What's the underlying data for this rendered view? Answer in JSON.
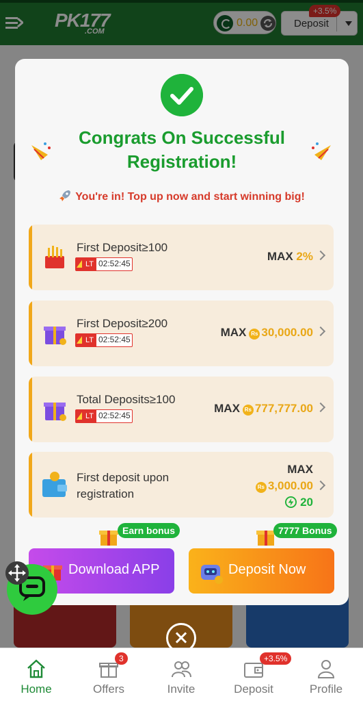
{
  "header": {
    "logo": "PK177",
    "logo_sub": ".COM",
    "balance": "0.00",
    "deposit_label": "Deposit",
    "deposit_badge": "+3.5%"
  },
  "modal": {
    "title": "Congrats On Successful Registration!",
    "subtitle": "You're in! Top up now and start winning big!",
    "bonuses": [
      {
        "title": "First Deposit≥100",
        "lt": "LT",
        "timer": "02:52:45",
        "max_label": "MAX",
        "max_value": "2%"
      },
      {
        "title": "First Deposit≥200",
        "lt": "LT",
        "timer": "02:52:45",
        "max_label": "MAX",
        "max_value": "30,000.00"
      },
      {
        "title": "Total Deposits≥100",
        "lt": "LT",
        "timer": "02:52:45",
        "max_label": "MAX",
        "max_value": "777,777.00"
      },
      {
        "title": "First deposit upon registration",
        "max_label": "MAX",
        "max_value": "3,000.00",
        "extra_value": "20"
      }
    ],
    "currency_symbol": "Rs",
    "earn_bonus": "Earn bonus",
    "bonus_7777": "7777 Bonus",
    "download_app": "Download APP",
    "deposit_now": "Deposit Now"
  },
  "nav": {
    "items": [
      {
        "label": "Home",
        "icon": "home-icon"
      },
      {
        "label": "Offers",
        "icon": "gift-icon",
        "badge": "3"
      },
      {
        "label": "Invite",
        "icon": "people-icon"
      },
      {
        "label": "Deposit",
        "icon": "wallet-icon",
        "badge": "+3.5%"
      },
      {
        "label": "Profile",
        "icon": "profile-icon"
      }
    ]
  },
  "colors": {
    "brand_green": "#1f7a30",
    "title_green": "#1a9c2e",
    "accent_orange": "#f1a719",
    "alert_red": "#e0322c"
  }
}
